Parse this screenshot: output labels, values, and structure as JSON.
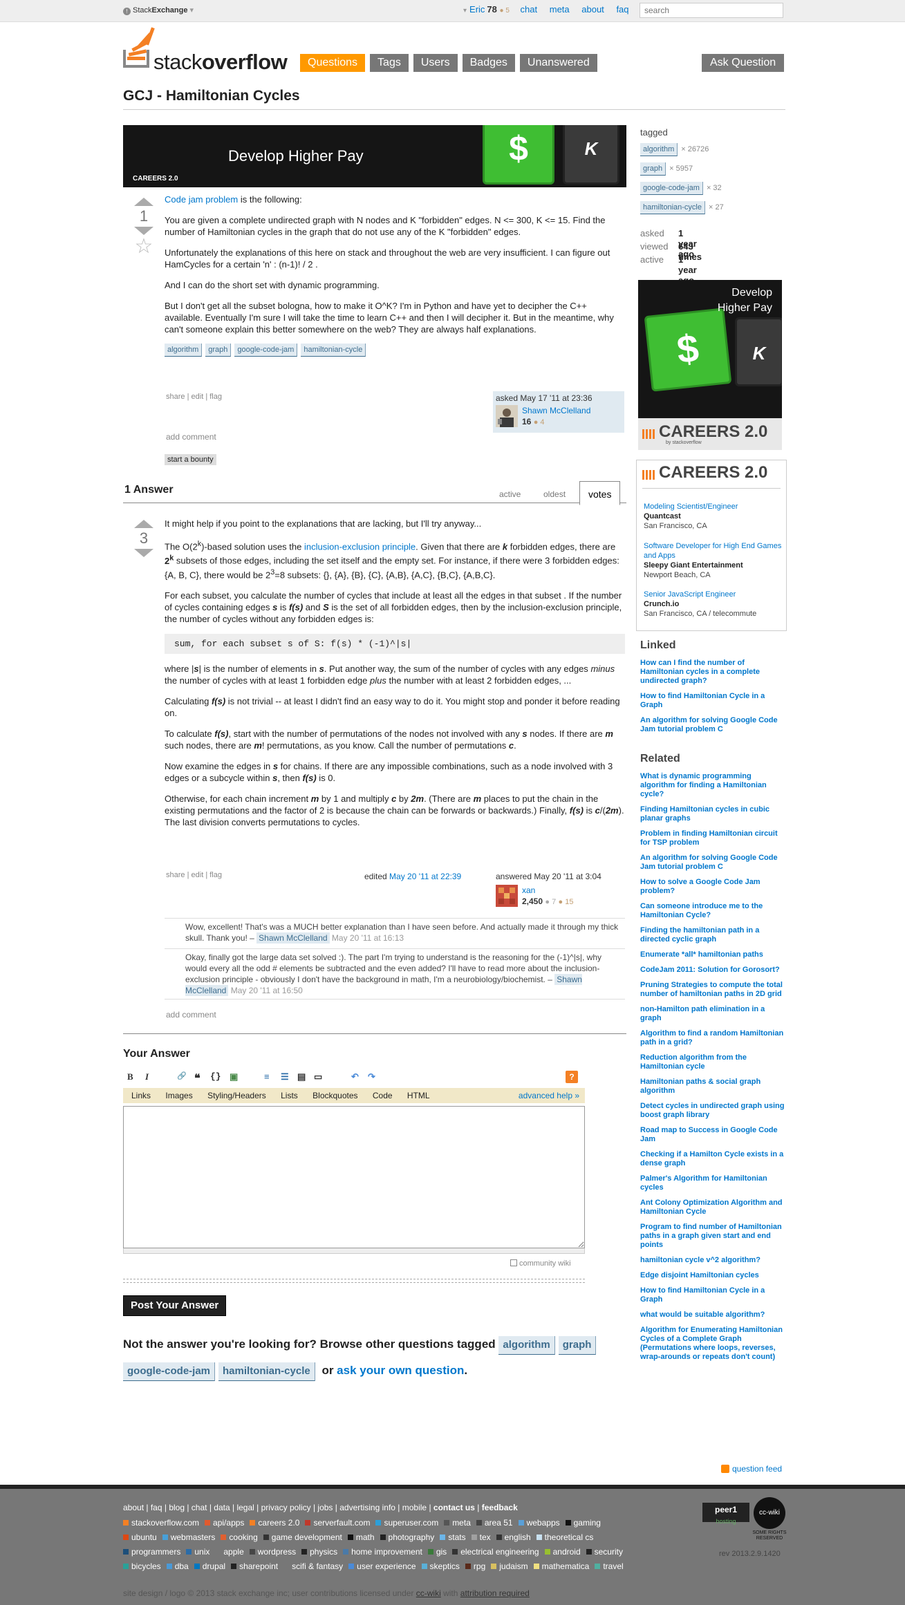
{
  "topbar": {
    "brand_prefix": "Stack",
    "brand_suffix": "Exchange",
    "brand_caret": "▾",
    "user": "Eric",
    "user_caret": "▾",
    "rep": "78",
    "bronze": "● 5",
    "links": [
      "chat",
      "meta",
      "about",
      "faq"
    ],
    "search_placeholder": "search"
  },
  "logo": {
    "light": "stack",
    "bold": "overflow"
  },
  "nav": [
    "Questions",
    "Tags",
    "Users",
    "Badges",
    "Unanswered"
  ],
  "ask_button": "Ask Question",
  "title": "GCJ - Hamiltonian Cycles",
  "banner": {
    "headline": "Develop Higher Pay",
    "brand": "CAREERS 2.0",
    "dollar": "$",
    "k": "K"
  },
  "question": {
    "votes": "1",
    "star": "☆",
    "intro_link": "Code jam problem",
    "intro_rest": " is the following:",
    "p1": "You are given a complete undirected graph with N nodes and K \"forbidden\" edges. N <= 300, K <= 15. Find the number of Hamiltonian cycles in the graph that do not use any of the K \"forbidden\" edges.",
    "p2": "Unfortunately the explanations of this here on stack and throughout the web are very insufficient. I can figure out HamCycles for a certain 'n' : (n-1)! / 2 .",
    "p3": "And I can do the short set with dynamic programming.",
    "p4": "But I don't get all the subset bologna, how to make it O^K? I'm in Python and have yet to decipher the C++ available. Eventually I'm sure I will take the time to learn C++ and then I will decipher it. But in the meantime, why can't someone explain this better somewhere on the web? They are always half explanations.",
    "tags": [
      "algorithm",
      "graph",
      "google-code-jam",
      "hamiltonian-cycle"
    ],
    "menu": {
      "share": "share",
      "edit": "edit",
      "flag": "flag",
      "sep": "|"
    },
    "asked": "asked May 17 '11 at 23:36",
    "user": "Shawn McClelland",
    "user_rep": "16",
    "user_badges": "● 4",
    "add_comment": "add comment",
    "bounty": "start a bounty"
  },
  "answers_header": {
    "count": "1 Answer",
    "tabs": [
      "active",
      "oldest",
      "votes"
    ]
  },
  "answer": {
    "votes": "3",
    "p1": "It might help if you point to the explanations that are lacking, but I'll try anyway...",
    "p2_a": "The O(2",
    "p2_sup": "k",
    "p2_b": ")-based solution uses the ",
    "p2_link": "inclusion-exclusion principle",
    "p2_c": ". Given that there are ",
    "p2_k": "k",
    "p2_d": " forbidden edges, there are ",
    "p2_2k": "2",
    "p2_2k_sup": "k",
    "p2_e": " subsets of those edges, including the set itself and the empty set. For instance, if there were 3 forbidden edges: {A, B, C}, there would be 2",
    "p2_3sup": "3",
    "p2_f": "=8 subsets: {}, {A}, {B}, {C}, {A,B}, {A,C}, {B,C}, {A,B,C}.",
    "p3_a": "For each subset, you calculate the number of cycles that include at least all the edges in that subset . If the number of cycles containing edges ",
    "p3_s": "s",
    "p3_b": " is ",
    "p3_fs": "f(s)",
    "p3_c": " and ",
    "p3_S": "S",
    "p3_d": " is the set of all forbidden edges, then by the inclusion-exclusion principle, the number of cycles without any forbidden edges is:",
    "code": "sum, for each subset s of S: f(s) * (-1)^|s|",
    "p4_a": "where |",
    "p4_s": "s",
    "p4_b": "| is the number of elements in ",
    "p4_s2": "s",
    "p4_c": ". Put another way, the sum of the number of cycles with any edges ",
    "p4_minus": "minus",
    "p4_d": " the number of cycles with at least 1 forbidden edge ",
    "p4_plus": "plus",
    "p4_e": " the number with at least 2 forbidden edges, ...",
    "p5_a": "Calculating ",
    "p5_fs": "f(s)",
    "p5_b": " is not trivial -- at least I didn't find an easy way to do it. You might stop and ponder it before reading on.",
    "p6_a": "To calculate ",
    "p6_fs": "f(s)",
    "p6_b": ", start with the number of permutations of the nodes not involved with any ",
    "p6_s": "s",
    "p6_c": " nodes. If there are ",
    "p6_m": "m",
    "p6_d": " such nodes, there are ",
    "p6_m2": "m",
    "p6_e": "! permutations, as you know. Call the number of permutations ",
    "p6_c2": "c",
    "p6_f": ".",
    "p7_a": "Now examine the edges in ",
    "p7_s": "s",
    "p7_b": " for chains. If there are any impossible combinations, such as a node involved with 3 edges or a subcycle within ",
    "p7_s2": "s",
    "p7_c": ", then ",
    "p7_fs": "f(s)",
    "p7_d": " is 0.",
    "p8_a": "Otherwise, for each chain increment ",
    "p8_m": "m",
    "p8_b": " by 1 and multiply ",
    "p8_c": "c",
    "p8_d": " by ",
    "p8_2m": "2m",
    "p8_e": ". (There are ",
    "p8_m2": "m",
    "p8_f": " places to put the chain in the existing permutations and the factor of 2 is because the chain can be forwards or backwards.) Finally, ",
    "p8_fs": "f(s)",
    "p8_g": " is ",
    "p8_cdiv": "c",
    "p8_h": "/(",
    "p8_2m2": "2m",
    "p8_i": "). The last division converts permutations to cycles.",
    "menu": {
      "share": "share",
      "edit": "edit",
      "flag": "flag",
      "sep": "|"
    },
    "edited_label": "edited ",
    "edited_date": "May 20 '11 at 22:39",
    "answered": "answered May 20 '11 at 3:04",
    "user": "xan",
    "user_rep": "2,450",
    "user_silver": "● 7",
    "user_bronze": "● 15",
    "comments": [
      {
        "text": "Wow, excellent! That's was a MUCH better explanation than I have seen before. And actually made it through my thick skull. Thank you! – ",
        "user": "Shawn McClelland",
        "date": " May 20 '11 at 16:13"
      },
      {
        "text": "Okay, finally got the large data set solved :). The part I'm trying to understand is the reasoning for the (-1)^|s|, why would every all the odd # elements be subtracted and the even added? I'll have to read more about the inclusion-exclusion principle - obviously I don't have the background in math, I'm a neurobiology/biochemist. – ",
        "user": "Shawn McClelland",
        "date": " May 20 '11 at 16:50"
      }
    ],
    "add_comment": "add comment"
  },
  "editor": {
    "heading": "Your Answer",
    "toolbar": [
      "B",
      "I",
      "🔗",
      "❝",
      "{}",
      "▣",
      "≡",
      "☰",
      "▤",
      "▭",
      "↶",
      "↷"
    ],
    "help_badge": "?",
    "help_links": [
      "Links",
      "Images",
      "Styling/Headers",
      "Lists",
      "Blockquotes",
      "Code",
      "HTML"
    ],
    "advanced_help": "advanced help »",
    "community_wiki": "community wiki",
    "post_button": "Post Your Answer"
  },
  "not_answer": {
    "prefix": "Not the answer you're looking for? Browse other questions tagged ",
    "tags": [
      "algorithm",
      "graph",
      "google-code-jam",
      "hamiltonian-cycle"
    ],
    "or": " or ",
    "ask_link": "ask your own question",
    "suffix": "."
  },
  "sidebar": {
    "tagged_label": "tagged",
    "tags": [
      {
        "name": "algorithm",
        "count": "× 26726"
      },
      {
        "name": "graph",
        "count": "× 5957"
      },
      {
        "name": "google-code-jam",
        "count": "× 32"
      },
      {
        "name": "hamiltonian-cycle",
        "count": "× 27"
      }
    ],
    "stats": [
      {
        "label": "asked",
        "value": "1 year ago"
      },
      {
        "label": "viewed",
        "value": "643 times"
      },
      {
        "label": "active",
        "value": "1 year ago"
      }
    ],
    "ad": {
      "line1": "Develop",
      "line2": "Higher Pay",
      "brand": "CAREERS 2.0",
      "byline": "by stackoverflow",
      "dollar": "$",
      "k": "K"
    },
    "jobs_brand": "CAREERS 2.0",
    "jobs": [
      {
        "title": "Modeling Scientist/Engineer",
        "company": "Quantcast",
        "location": "San Francisco, CA"
      },
      {
        "title": "Software Developer for High End Games and Apps",
        "company": "Sleepy Giant Entertainment",
        "location": "Newport Beach, CA"
      },
      {
        "title": "Senior JavaScript Engineer",
        "company": "Crunch.io",
        "location": "San Francisco, CA / telecommute"
      }
    ],
    "linked_heading": "Linked",
    "linked": [
      "How can I find the number of Hamiltonian cycles in a complete undirected graph?",
      "How to find Hamiltonian Cycle in a Graph",
      "An algorithm for solving Google Code Jam tutorial problem C"
    ],
    "related_heading": "Related",
    "related": [
      "What is dynamic programming algorithm for finding a Hamiltonian cycle?",
      "Finding Hamiltonian cycles in cubic planar graphs",
      "Problem in finding Hamiltonian circuit for TSP problem",
      "An algorithm for solving Google Code Jam tutorial problem C",
      "How to solve a Google Code Jam problem?",
      "Can someone introduce me to the Hamiltonian Cycle?",
      "Finding the hamiltonian path in a directed cyclic graph",
      "Enumerate *all* hamiltonian paths",
      "CodeJam 2011: Solution for Gorosort?",
      "Pruning Strategies to compute the total number of hamiltonian paths in 2D grid",
      "non-Hamilton path elimination in a graph",
      "Algorithm to find a random Hamiltonian path in a grid?",
      "Reduction algorithm from the Hamiltonian cycle",
      "Hamiltonian paths & social graph algorithm",
      "Detect cycles in undirected graph using boost graph library",
      "Road map to Success in Google Code Jam",
      "Checking if a Hamilton Cycle exists in a dense graph",
      "Palmer's Algorithm for Hamiltonian cycles",
      "Ant Colony Optimization Algorithm and Hamiltonian Cycle",
      "Program to find number of Hamiltonian paths in a graph given start and end points",
      "hamiltonian cycle v^2 algorithm?",
      "Edge disjoint Hamiltonian cycles",
      "How to find Hamiltonian Cycle in a Graph",
      "what would be suitable algorithm?",
      "Algorithm for Enumerating Hamiltonian Cycles of a Complete Graph (Permutations where loops, reverses, wrap-arounds or repeats don't count)"
    ]
  },
  "question_feed": "question feed",
  "footer": {
    "links": [
      "about",
      "faq",
      "blog",
      "chat",
      "data",
      "legal",
      "privacy policy",
      "jobs",
      "advertising info",
      "mobile",
      "contact us",
      "feedback"
    ],
    "sep": " | ",
    "sites_row1": [
      {
        "name": "stackoverflow.com",
        "color": "#f48024"
      },
      {
        "name": "api/apps",
        "color": "#e05a2e"
      },
      {
        "name": "careers 2.0",
        "color": "#f48024"
      },
      {
        "name": "serverfault.com",
        "color": "#c0392b"
      },
      {
        "name": "superuser.com",
        "color": "#2d9fd8"
      },
      {
        "name": "meta",
        "color": "#555555"
      },
      {
        "name": "area 51",
        "color": "#444444"
      },
      {
        "name": "webapps",
        "color": "#5aa0d8"
      },
      {
        "name": "gaming",
        "color": "#111111"
      }
    ],
    "sites_row2": [
      {
        "name": "ubuntu",
        "color": "#dd4814"
      },
      {
        "name": "webmasters",
        "color": "#48a0d8"
      },
      {
        "name": "cooking",
        "color": "#e06030"
      },
      {
        "name": "game development",
        "color": "#333333"
      },
      {
        "name": "math",
        "color": "#111111"
      },
      {
        "name": "photography",
        "color": "#222222"
      },
      {
        "name": "stats",
        "color": "#6cb5e8"
      },
      {
        "name": "tex",
        "color": "#a0a0a0"
      },
      {
        "name": "english",
        "color": "#333333"
      },
      {
        "name": "theoretical cs",
        "color": "#c8e0f0"
      }
    ],
    "sites_row3": [
      {
        "name": "programmers",
        "color": "#1d4f7a"
      },
      {
        "name": "unix",
        "color": "#2a6ca8"
      },
      {
        "name": "apple",
        "color": "#777777"
      },
      {
        "name": "wordpress",
        "color": "#464646"
      },
      {
        "name": "physics",
        "color": "#222222"
      },
      {
        "name": "home improvement",
        "color": "#4a7aa8"
      },
      {
        "name": "gis",
        "color": "#3a7a3a"
      },
      {
        "name": "electrical engineering",
        "color": "#333333"
      },
      {
        "name": "android",
        "color": "#98c030"
      },
      {
        "name": "security",
        "color": "#222222"
      }
    ],
    "sites_row4": [
      {
        "name": "bicycles",
        "color": "#2aa198"
      },
      {
        "name": "dba",
        "color": "#4a9ad8"
      },
      {
        "name": "drupal",
        "color": "#0077c0"
      },
      {
        "name": "sharepoint",
        "color": "#222222"
      },
      {
        "name": "scifi & fantasy",
        "color": "#777777"
      },
      {
        "name": "user experience",
        "color": "#4a8ad8"
      },
      {
        "name": "skeptics",
        "color": "#5ab0d8"
      },
      {
        "name": "rpg",
        "color": "#5a2a1a"
      },
      {
        "name": "judaism",
        "color": "#d8c060"
      },
      {
        "name": "mathematica",
        "color": "#f0e080"
      },
      {
        "name": "travel",
        "color": "#50b0a0"
      }
    ],
    "copy_a": "site design / logo © 2013 stack exchange inc; user contributions licensed under ",
    "copy_ccwiki": "cc-wiki",
    "copy_b": " with ",
    "copy_attr": "attribution required",
    "rev": "rev 2013.2.9.1420",
    "peer1_top": "peer1",
    "peer1_bottom": "hosting",
    "ccwiki_badge": "cc-wiki",
    "ccwiki_caption": "SOME RIGHTS RESERVED"
  }
}
